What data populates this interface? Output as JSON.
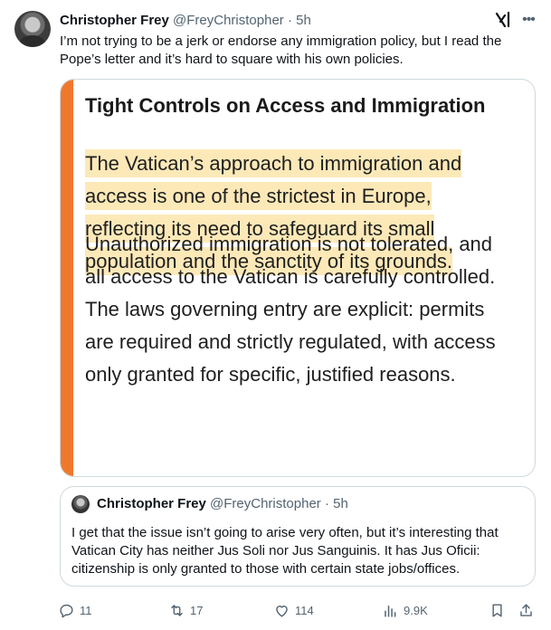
{
  "tweet": {
    "author_name": "Christopher Frey",
    "author_handle": "@FreyChristopher",
    "separator": " · ",
    "time": "5h",
    "text": "I’m not trying to be a jerk or endorse any immigration policy, but I read the Pope’s letter and it’s hard to square with his own policies."
  },
  "media": {
    "heading": "Tight Controls on Access and Immigration",
    "highlight_lines": [
      "The Vatican’s approach to immigration and",
      "access is one of the strictest in Europe,",
      "reflecting its need to safeguard its small",
      "population and the sanctity of its grounds."
    ],
    "body": "Unauthorized immigration is not tolerated, and all access to the Vatican is carefully controlled. The laws governing entry are explicit: permits are required and strictly regulated, with access only granted for specific, justified reasons.",
    "highlight_color": "#fde9b8",
    "accent_color": "#f0782d"
  },
  "quote": {
    "author_name": "Christopher Frey",
    "author_handle": "@FreyChristopher",
    "separator": " · ",
    "time": "5h",
    "text": "I get that the issue isn’t going to arise very often, but it’s interesting that Vatican City has neither Jus Soli nor Jus Sanguinis. It has Jus Oficii: citizenship is only granted to those with certain state jobs/offices."
  },
  "actions": {
    "replies": "11",
    "reposts": "17",
    "likes": "114",
    "views": "9.9K"
  },
  "icons": [
    "grok-icon",
    "more-icon",
    "reply-icon",
    "repost-icon",
    "like-icon",
    "views-icon",
    "bookmark-icon",
    "share-icon"
  ]
}
